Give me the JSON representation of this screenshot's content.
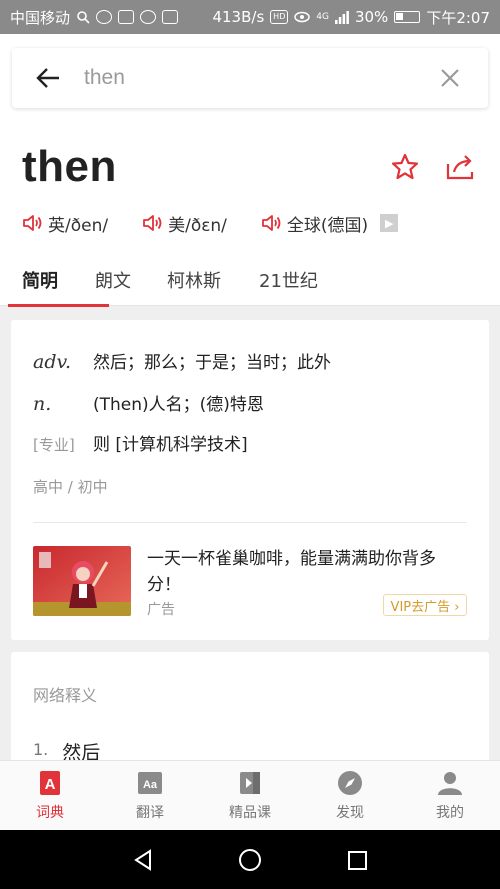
{
  "status_bar": {
    "carrier": "中国移动",
    "speed": "413B/s",
    "hd": "HD",
    "network": "4G",
    "battery": "30%",
    "time": "下午2:07"
  },
  "search": {
    "query": "then"
  },
  "entry": {
    "word": "then",
    "phonetics": [
      {
        "label": "英/ðen/"
      },
      {
        "label": "美/ðɛn/"
      },
      {
        "label": "全球(德国)"
      }
    ]
  },
  "tabs": [
    {
      "label": "简明",
      "active": true
    },
    {
      "label": "朗文",
      "active": false
    },
    {
      "label": "柯林斯",
      "active": false
    },
    {
      "label": "21世纪",
      "active": false
    }
  ],
  "definitions": [
    {
      "pos": "adv.",
      "text": "然后；那么；于是；当时；此外"
    },
    {
      "pos": "n.",
      "text": "(Then)人名；(德)特恩"
    },
    {
      "pos": "[专业]",
      "text": "则 [计算机科学技术]"
    }
  ],
  "level": "高中 / 初中",
  "ad": {
    "text": "一天一杯雀巢咖啡，能量满满助你背多分！",
    "label": "广告",
    "button": "VIP去广告 ›"
  },
  "web_section": {
    "title": "网络释义",
    "items": [
      {
        "num": "1.",
        "text": "然后"
      }
    ]
  },
  "bottom_nav": [
    {
      "label": "词典",
      "icon": "dictionary-icon",
      "active": true
    },
    {
      "label": "翻译",
      "icon": "translate-icon",
      "active": false
    },
    {
      "label": "精品课",
      "icon": "course-icon",
      "active": false
    },
    {
      "label": "发现",
      "icon": "compass-icon",
      "active": false
    },
    {
      "label": "我的",
      "icon": "profile-icon",
      "active": false
    }
  ],
  "colors": {
    "accent": "#e0333a",
    "ad_button": "#d59a2a"
  }
}
